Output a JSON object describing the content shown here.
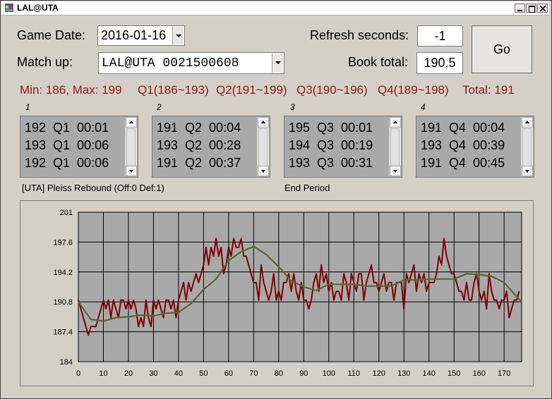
{
  "window": {
    "title": "LAL@UTA",
    "icon": "app-icon"
  },
  "form": {
    "game_date_label": "Game Date:",
    "game_date_value": "2016-01-16",
    "matchup_label": "Match up:",
    "matchup_value": "LAL@UTA 0021500608",
    "refresh_label": "Refresh seconds:",
    "refresh_value": "-1",
    "book_total_label": "Book total:",
    "book_total_value": "190.5",
    "go_label": "Go"
  },
  "stats": {
    "minmax": "Min: 186, Max: 199",
    "q1": "Q1(186~193)",
    "q2": "Q2(191~199)",
    "q3": "Q3(190~196)",
    "q4": "Q4(189~198)",
    "total": "Total: 191"
  },
  "quarters": [
    {
      "label": "1",
      "rows": [
        "192  Q1  00:01",
        "193  Q1  00:06",
        "192  Q1  00:06"
      ]
    },
    {
      "label": "2",
      "rows": [
        "191  Q2  00:04",
        "193  Q2  00:28",
        "191  Q2  00:37"
      ]
    },
    {
      "label": "3",
      "rows": [
        "195  Q3  00:01",
        "194  Q3  00:19",
        "193  Q3  00:31"
      ]
    },
    {
      "label": "4",
      "rows": [
        "191  Q4  00:04",
        "193  Q4  00:39",
        "191  Q4  00:45"
      ]
    }
  ],
  "status": {
    "last_play": "[UTA] Pleiss Rebound (Off:0 Def:1)",
    "period_status": "End Period"
  },
  "chart_data": {
    "type": "line",
    "ylim": [
      184,
      201
    ],
    "xlim": [
      0,
      177
    ],
    "yticks": [
      "184",
      "187.4",
      "190.8",
      "194.2",
      "197.6",
      "201"
    ],
    "xticks": [
      "0",
      "10",
      "20",
      "30",
      "40",
      "50",
      "60",
      "70",
      "80",
      "90",
      "100",
      "110",
      "120",
      "130",
      "140",
      "150",
      "160",
      "170"
    ],
    "grid": true,
    "colors": {
      "total": "#800000",
      "average": "#556b2f",
      "plot_bg": "#a9a9a9"
    },
    "series": [
      {
        "x": [
          0,
          2,
          4,
          5,
          7,
          8,
          10,
          11,
          12,
          13,
          14,
          16,
          17,
          18,
          19,
          20,
          21,
          22,
          23,
          24,
          25,
          26,
          27,
          28,
          29,
          30,
          31,
          32,
          33,
          34,
          35,
          36,
          37,
          38,
          39,
          40,
          41,
          42,
          43,
          44,
          45,
          46,
          47,
          48,
          49,
          50,
          51,
          52,
          53,
          54,
          55,
          56,
          57,
          58,
          59,
          60,
          61,
          62,
          63,
          64,
          65,
          66,
          67,
          68,
          69,
          70,
          71,
          72,
          73,
          74,
          75,
          76,
          77,
          78,
          79,
          80,
          81,
          82,
          83,
          84,
          85,
          86,
          87,
          88,
          89,
          90,
          91,
          92,
          93,
          94,
          95,
          96,
          97,
          98,
          99,
          100,
          101,
          102,
          103,
          104,
          105,
          106,
          107,
          108,
          109,
          110,
          111,
          112,
          113,
          114,
          115,
          116,
          117,
          118,
          119,
          120,
          121,
          122,
          123,
          124,
          125,
          126,
          127,
          128,
          129,
          130,
          131,
          132,
          133,
          134,
          135,
          136,
          137,
          138,
          139,
          140,
          141,
          142,
          143,
          144,
          145,
          146,
          147,
          148,
          149,
          150,
          151,
          152,
          153,
          154,
          155,
          156,
          157,
          158,
          159,
          160,
          161,
          162,
          163,
          164,
          165,
          166,
          167,
          168,
          169,
          170,
          171,
          172,
          173,
          174,
          175,
          176
        ],
        "values": [
          191,
          189,
          187,
          188,
          188,
          189,
          191,
          190,
          191,
          189,
          191,
          189,
          191,
          191,
          190,
          191,
          190,
          191,
          190,
          188,
          189,
          188,
          191,
          189,
          188,
          191,
          190,
          191,
          190,
          189,
          191,
          191,
          190,
          191,
          189,
          191,
          192,
          193,
          191,
          193,
          192,
          193,
          194,
          193,
          194,
          195,
          197,
          195,
          197,
          196,
          198,
          196,
          197,
          194,
          195,
          197,
          196,
          198,
          197,
          197,
          198,
          196,
          196,
          195,
          194,
          193,
          193,
          191,
          195,
          193,
          192,
          191,
          192,
          194,
          191,
          192,
          191,
          193,
          193,
          194,
          192,
          194,
          192,
          191,
          193,
          191,
          191,
          190,
          191,
          193,
          194,
          192,
          195,
          193,
          194,
          192,
          193,
          191,
          192,
          192,
          191,
          194,
          193,
          191,
          194,
          193,
          192,
          194,
          194,
          191,
          193,
          194,
          195,
          193,
          193,
          192,
          193,
          194,
          192,
          193,
          193,
          191,
          193,
          193,
          193,
          190,
          194,
          193,
          194,
          195,
          192,
          194,
          193,
          194,
          192,
          193,
          193,
          193,
          194,
          196,
          195,
          198,
          196,
          195,
          194,
          194,
          193,
          192,
          192,
          191,
          193,
          191,
          191,
          193,
          194,
          192,
          191,
          192,
          190,
          194,
          192,
          191,
          191,
          190,
          191,
          191,
          192,
          189,
          190,
          191,
          191,
          192
        ],
        "note_unused": ""
      },
      {
        "x": [
          0,
          5,
          10,
          15,
          20,
          25,
          30,
          35,
          40,
          45,
          50,
          55,
          60,
          65,
          70,
          75,
          80,
          85,
          90,
          95,
          100,
          105,
          110,
          115,
          120,
          125,
          130,
          135,
          140,
          145,
          150,
          155,
          160,
          165,
          170,
          175,
          177
        ],
        "values": [
          190.8,
          188.8,
          188.6,
          189.0,
          189.1,
          189.3,
          189.2,
          189.5,
          189.6,
          190.6,
          192.2,
          193.4,
          195.5,
          196.5,
          197.1,
          196.2,
          194.8,
          193.2,
          192.5,
          192.1,
          192.8,
          192.8,
          192.8,
          192.6,
          192.6,
          192.6,
          193.3,
          193.3,
          193.4,
          193.4,
          193.4,
          194.0,
          193.9,
          193.7,
          193.0,
          191.4,
          190.8
        ]
      }
    ]
  }
}
